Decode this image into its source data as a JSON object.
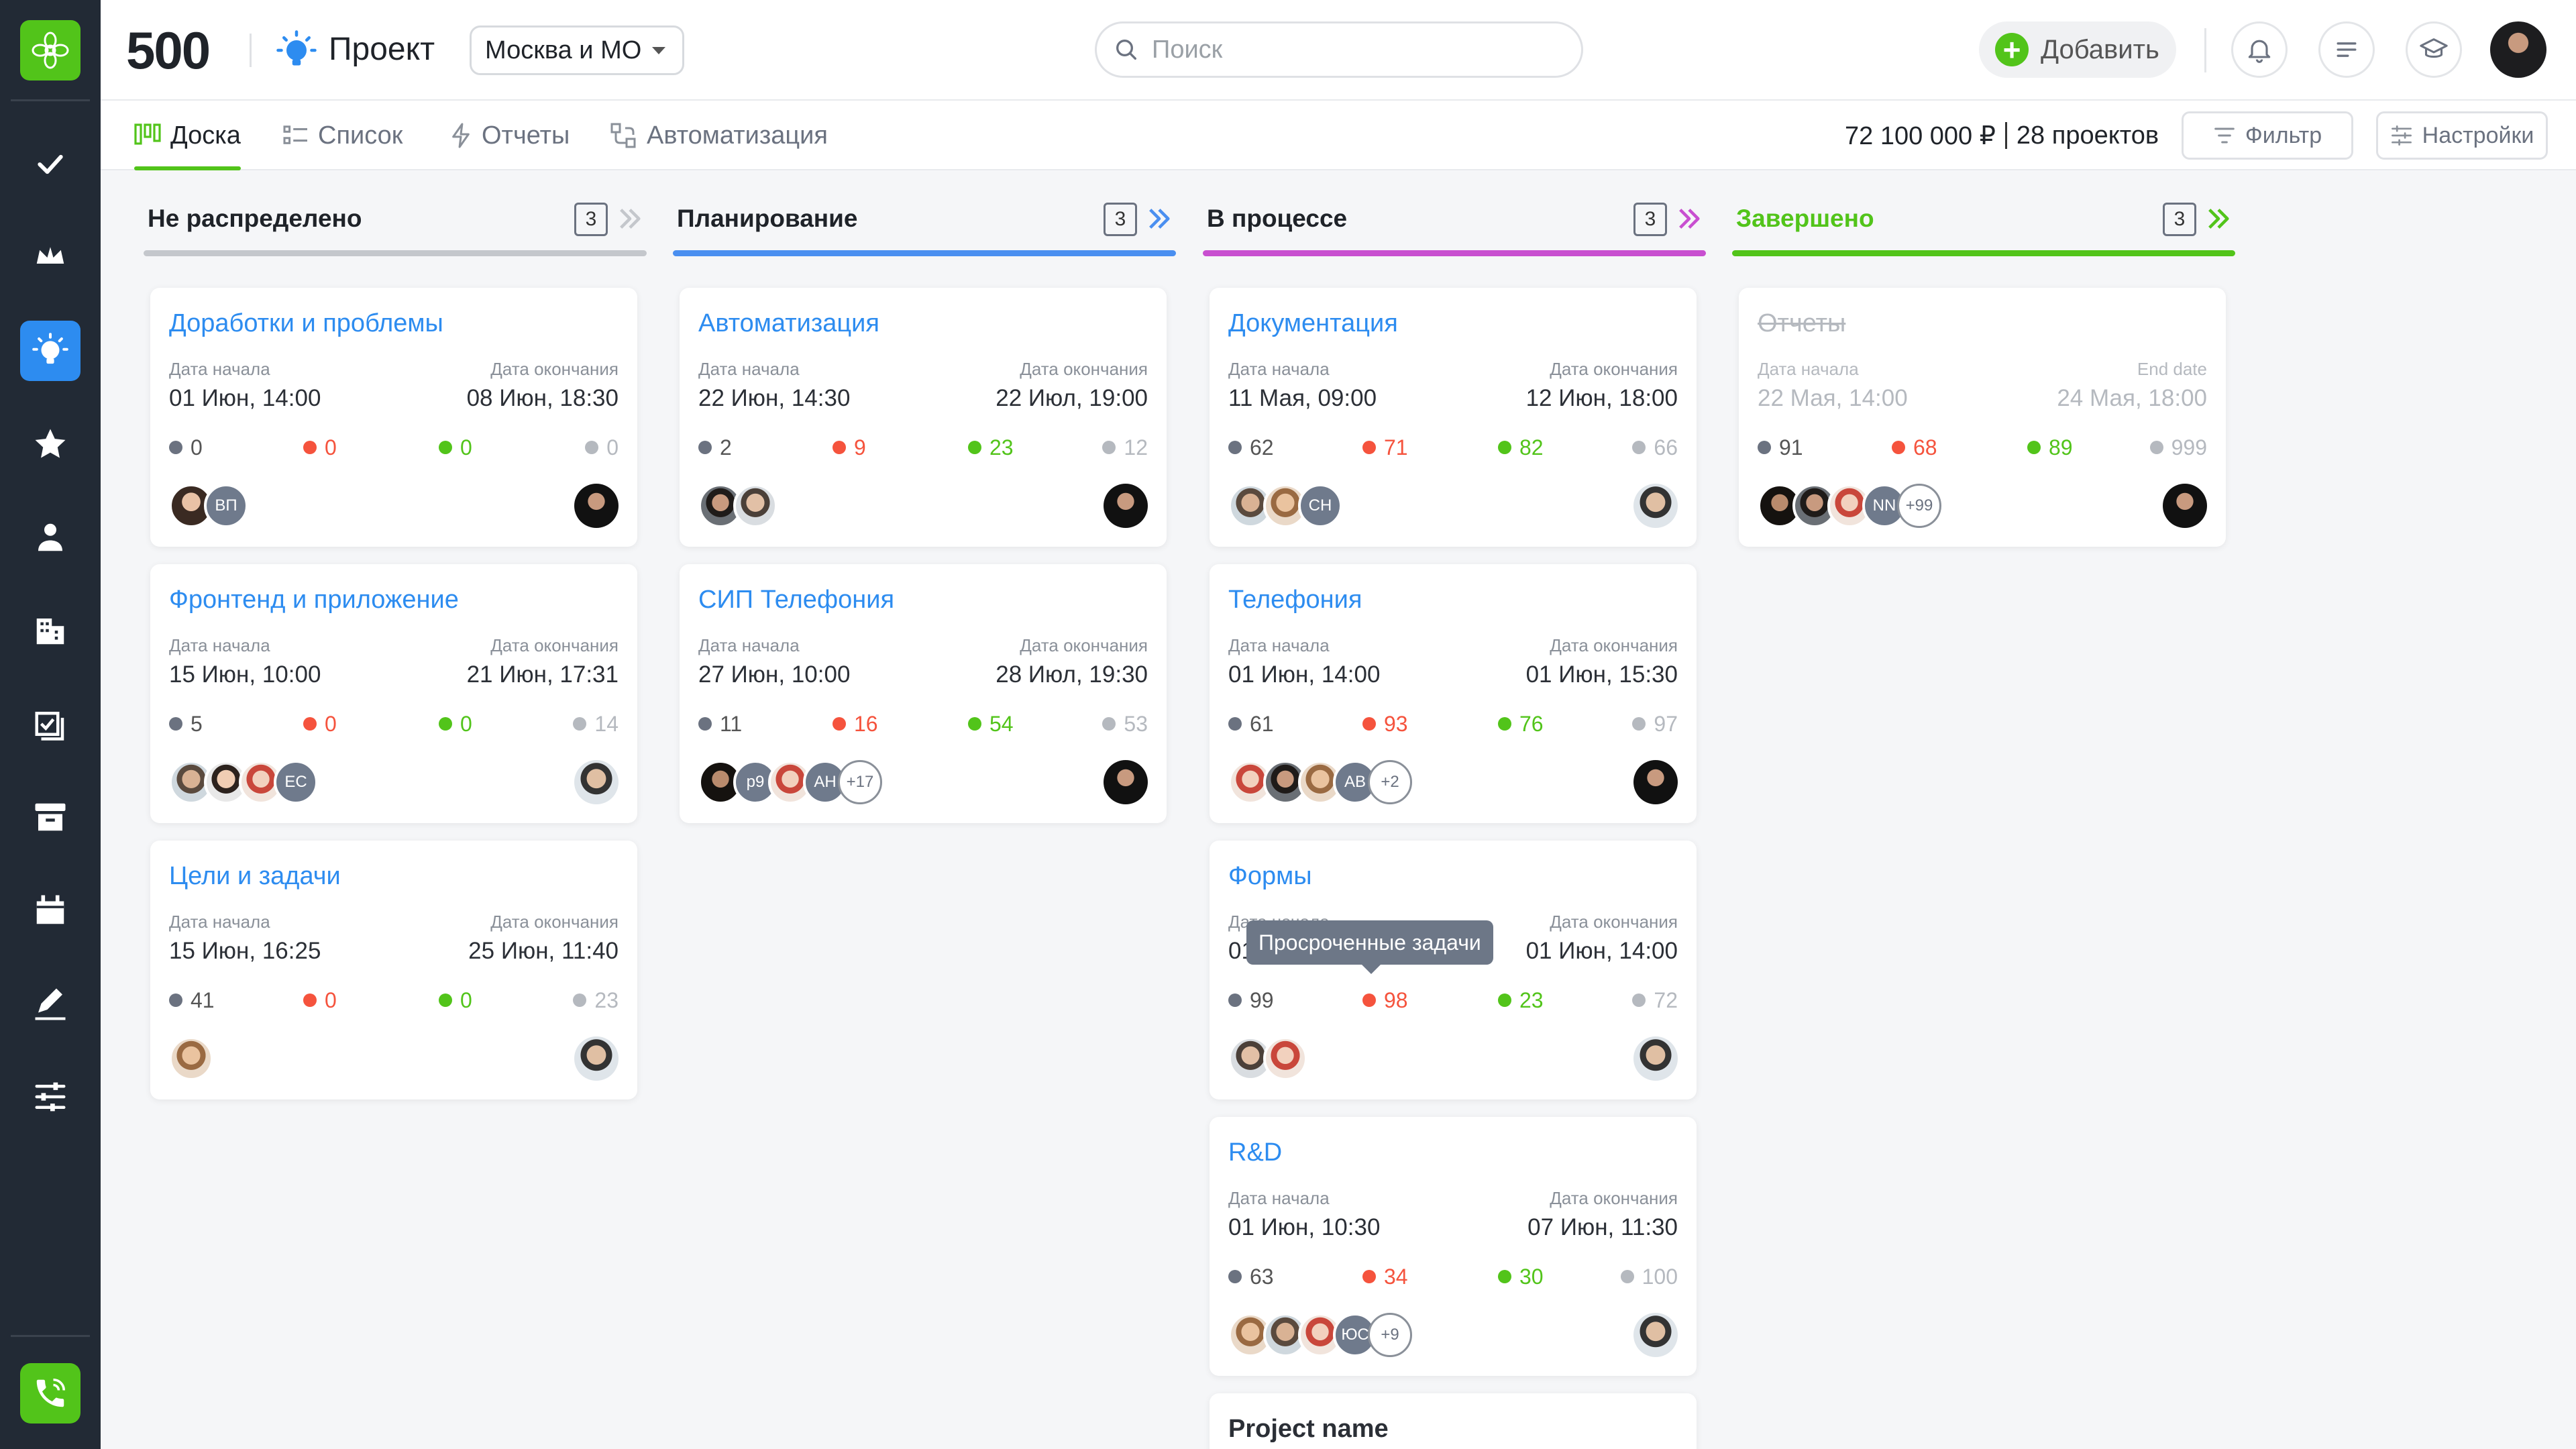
{
  "header": {
    "count": "500",
    "title": "Проект",
    "region": "Москва и МО",
    "search_placeholder": "Поиск",
    "add_label": "Добавить"
  },
  "sidebar": {
    "items": [
      "check-icon",
      "crown-icon",
      "bulb-icon",
      "star-icon",
      "user-icon",
      "building-icon",
      "tasks-icon",
      "archive-icon",
      "calendar-icon",
      "pen-icon",
      "sliders-icon"
    ],
    "active_index": 2
  },
  "toolbar": {
    "tabs": [
      {
        "label": "Доска",
        "icon": "board-icon",
        "active": true
      },
      {
        "label": "Список",
        "icon": "list-icon",
        "active": false
      },
      {
        "label": "Отчеты",
        "icon": "bolt-icon",
        "active": false
      },
      {
        "label": "Автоматизация",
        "icon": "automation-icon",
        "active": false
      }
    ],
    "total_amount": "72 100 000 ₽",
    "projects_count": "28 проектов",
    "filter_label": "Фильтр",
    "settings_label": "Настройки"
  },
  "colors": {
    "accent_green": "#52c41a",
    "link_blue": "#2d8cf0",
    "red": "#f5533d",
    "grey_dot": "#6b7280",
    "light_dot": "#b5b9bf",
    "purple": "#c84fd0",
    "blue_line": "#4a8ff0"
  },
  "tooltip": "Просроченные задачи",
  "columns": [
    {
      "title": "Не распределено",
      "count": "3",
      "color": "#c4c7cc",
      "title_color": "#1f2329",
      "cards": [
        {
          "title": "Доработки и проблемы",
          "start_label": "Дата начала",
          "start": "01 Июн, 14:00",
          "end_label": "Дата окончания",
          "end": "08 Июн, 18:30",
          "stats": [
            "0",
            "0",
            "0",
            "0"
          ],
          "avatars": [
            "p1",
            "ВП"
          ],
          "more": ""
        },
        {
          "title": "Фронтенд и приложение",
          "start_label": "Дата начала",
          "start": "15 Июн, 10:00",
          "end_label": "Дата окончания",
          "end": "21 Июн, 17:31",
          "stats": [
            "5",
            "0",
            "0",
            "14"
          ],
          "avatars": [
            "p2",
            "p3",
            "p4",
            "ЕС"
          ],
          "more": ""
        },
        {
          "title": "Цели и задачи",
          "start_label": "Дата начала",
          "start": "15 Июн, 16:25",
          "end_label": "Дата окончания",
          "end": "25 Июн, 11:40",
          "stats": [
            "41",
            "0",
            "0",
            "23"
          ],
          "avatars": [
            "p5"
          ],
          "more": ""
        }
      ]
    },
    {
      "title": "Планирование",
      "count": "3",
      "color": "#4a8ff0",
      "title_color": "#1f2329",
      "cards": [
        {
          "title": "Автоматизация",
          "start_label": "Дата начала",
          "start": "22 Июн, 14:30",
          "end_label": "Дата окончания",
          "end": "22 Июл, 19:00",
          "stats": [
            "2",
            "9",
            "23",
            "12"
          ],
          "avatars": [
            "p6",
            "p7"
          ],
          "more": ""
        },
        {
          "title": "СИП Телефония",
          "start_label": "Дата начала",
          "start": "27 Июн, 10:00",
          "end_label": "Дата окончания",
          "end": "28 Июл, 19:30",
          "stats": [
            "11",
            "16",
            "54",
            "53"
          ],
          "avatars": [
            "p8",
            "p9",
            "p4",
            "АН"
          ],
          "more": "+17"
        }
      ]
    },
    {
      "title": "В процессе",
      "count": "3",
      "color": "#c84fd0",
      "title_color": "#1f2329",
      "cards": [
        {
          "title": "Документация",
          "start_label": "Дата начала",
          "start": "11 Мая, 09:00",
          "end_label": "Дата окончания",
          "end": "12 Июн, 18:00",
          "stats": [
            "62",
            "71",
            "82",
            "66"
          ],
          "avatars": [
            "p2",
            "p5",
            "СН"
          ],
          "more": ""
        },
        {
          "title": "Телефония",
          "start_label": "Дата начала",
          "start": "01 Июн, 14:00",
          "end_label": "Дата окончания",
          "end": "01 Июн, 15:30",
          "stats": [
            "61",
            "93",
            "76",
            "97"
          ],
          "avatars": [
            "p4",
            "p6",
            "p5",
            "АВ"
          ],
          "more": "+2"
        },
        {
          "title": "Формы",
          "start_label": "Дата начала",
          "start": "01 Июн, 10:00",
          "end_label": "Дата окончания",
          "end": "01 Июн, 14:00",
          "stats": [
            "99",
            "98",
            "23",
            "72"
          ],
          "avatars": [
            "p7",
            "p4"
          ],
          "more": ""
        },
        {
          "title": "R&D",
          "start_label": "Дата начала",
          "start": "01 Июн, 10:30",
          "end_label": "Дата окончания",
          "end": "07 Июн, 11:30",
          "stats": [
            "63",
            "34",
            "30",
            "100"
          ],
          "avatars": [
            "p5",
            "p2",
            "p4",
            "ЮС"
          ],
          "more": "+9"
        },
        {
          "title": "Project name",
          "plain": true
        }
      ]
    },
    {
      "title": "Завершено",
      "count": "3",
      "color": "#52c41a",
      "title_color": "#52c41a",
      "cards": [
        {
          "title": "Отчеты",
          "done": true,
          "start_label": "Дата начала",
          "start": "22 Мая, 14:00",
          "end_label": "End date",
          "end": "24 Мая, 18:00",
          "stats": [
            "91",
            "68",
            "89",
            "999"
          ],
          "avatars": [
            "p8",
            "p6",
            "p4",
            "NN"
          ],
          "more": "+99"
        }
      ]
    }
  ]
}
